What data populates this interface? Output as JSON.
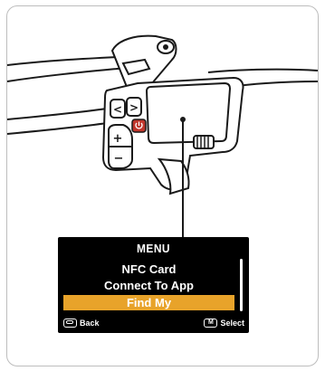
{
  "device_screen": {
    "title": "MENU",
    "items": [
      "NFC Card",
      "Connect To App",
      "Find My"
    ],
    "selected_index": 2,
    "footer": {
      "back_label": "Back",
      "select_label": "Select",
      "select_key": "M"
    }
  },
  "controller_buttons": {
    "left_arrow": "<",
    "right_arrow": ">",
    "plus": "+",
    "minus": "−"
  },
  "colors": {
    "highlight": "#e8a32a",
    "power_button": "#c0362c",
    "screen_background": "#000000",
    "outline": "#1a1a1a"
  },
  "icons": [
    "back-icon",
    "m-key-icon",
    "power-icon",
    "scroll-indicator"
  ]
}
